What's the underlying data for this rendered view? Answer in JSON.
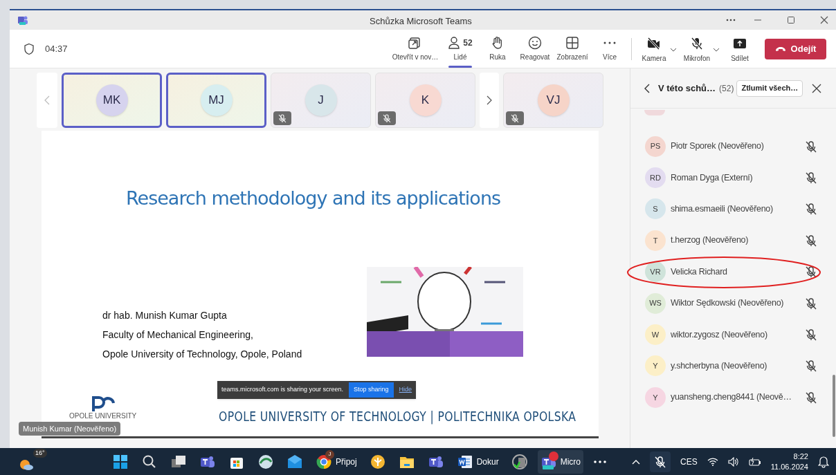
{
  "window": {
    "title": "Schůzka Microsoft Teams"
  },
  "meeting": {
    "timer": "04:37"
  },
  "toolbar": [
    {
      "label": "Otevřít v nov…",
      "selected": false
    },
    {
      "label": "Lidé",
      "count": "52",
      "selected": true
    },
    {
      "label": "Ruka",
      "selected": false
    },
    {
      "label": "Reagovat",
      "selected": false
    },
    {
      "label": "Zobrazení",
      "selected": false
    },
    {
      "label": "Více",
      "selected": false
    }
  ],
  "device_controls": [
    {
      "label": "Kamera",
      "dropdown": true
    },
    {
      "label": "Mikrofon",
      "dropdown": true
    },
    {
      "label": "Sdílet",
      "dropdown": false
    }
  ],
  "leave_button": "Odejít",
  "thumbnails": [
    {
      "initials": "MK",
      "highlighted": true,
      "muted": false,
      "color": "#d6d3ee"
    },
    {
      "initials": "MJ",
      "highlighted": true,
      "muted": false,
      "color": "#d7eef0"
    },
    {
      "initials": "J",
      "highlighted": false,
      "muted": true,
      "color": "#d8e6ea"
    },
    {
      "initials": "K",
      "highlighted": false,
      "muted": true,
      "color": "#f8d9d2"
    },
    {
      "initials": "VJ",
      "highlighted": false,
      "muted": true,
      "color": "#f6d4c8"
    }
  ],
  "slide": {
    "title": "Research methodology and its applications",
    "author_lines": [
      "dr hab. Munish Kumar Gupta",
      "Faculty of Mechanical Engineering,",
      "Opole University of Technology, Opole, Poland"
    ],
    "logo_text": "OPOLE UNIVERSITY",
    "footer": "OPOLE UNIVERSITY OF TECHNOLOGY | POLITECHNIKA OPOLSKA"
  },
  "share_bar": {
    "message": "teams.microsoft.com is sharing your screen.",
    "stop_button": "Stop sharing",
    "hide_link": "Hide"
  },
  "presenter_label": "Munish Kumar (Neověřeno)",
  "people_panel": {
    "title": "V této schů…",
    "count": "(52)",
    "mute_all_button": "Ztlumit všech…",
    "participants": [
      {
        "initials": "PS",
        "name": "Piotr Sporek (Neověřeno)",
        "color": "#f4d6cf",
        "muted": true
      },
      {
        "initials": "RD",
        "name": "Roman Dyga (Externí)",
        "color": "#e3dcf0",
        "muted": true
      },
      {
        "initials": "S",
        "name": "shima.esmaeili (Neověřeno)",
        "color": "#d6e6ec",
        "muted": true
      },
      {
        "initials": "T",
        "name": "t.herzog (Neověřeno)",
        "color": "#fbe3cf",
        "muted": true
      },
      {
        "initials": "VR",
        "name": "Velicka Richard",
        "color": "#cfe3da",
        "muted": true
      },
      {
        "initials": "WS",
        "name": "Wiktor Sędkowski (Neověřeno)",
        "color": "#e0ecd8",
        "muted": true
      },
      {
        "initials": "W",
        "name": "wiktor.zygosz (Neověřeno)",
        "color": "#fcefc7",
        "muted": true
      },
      {
        "initials": "Y",
        "name": "y.shcherbyna (Neověřeno)",
        "color": "#fcefc7",
        "muted": true
      },
      {
        "initials": "Y",
        "name": "yuansheng.cheng8441 (Neově…",
        "color": "#f6d6e2",
        "muted": true
      }
    ]
  },
  "taskbar": {
    "weather": "16°",
    "apps": [
      {
        "kind": "start"
      },
      {
        "kind": "search"
      },
      {
        "kind": "taskview"
      },
      {
        "kind": "teams"
      },
      {
        "kind": "store"
      },
      {
        "kind": "globe"
      },
      {
        "kind": "mail"
      },
      {
        "kind": "chrome",
        "label": "Připoj",
        "badge": "J"
      },
      {
        "kind": "yellow"
      },
      {
        "kind": "folder"
      },
      {
        "kind": "teams"
      },
      {
        "kind": "word",
        "label": "Dokur"
      },
      {
        "kind": "cd"
      },
      {
        "kind": "teamsnew",
        "label": "Micro",
        "active": true
      },
      {
        "kind": "more"
      }
    ],
    "language": "CES",
    "time": "8:22",
    "date": "11.06.2024"
  }
}
